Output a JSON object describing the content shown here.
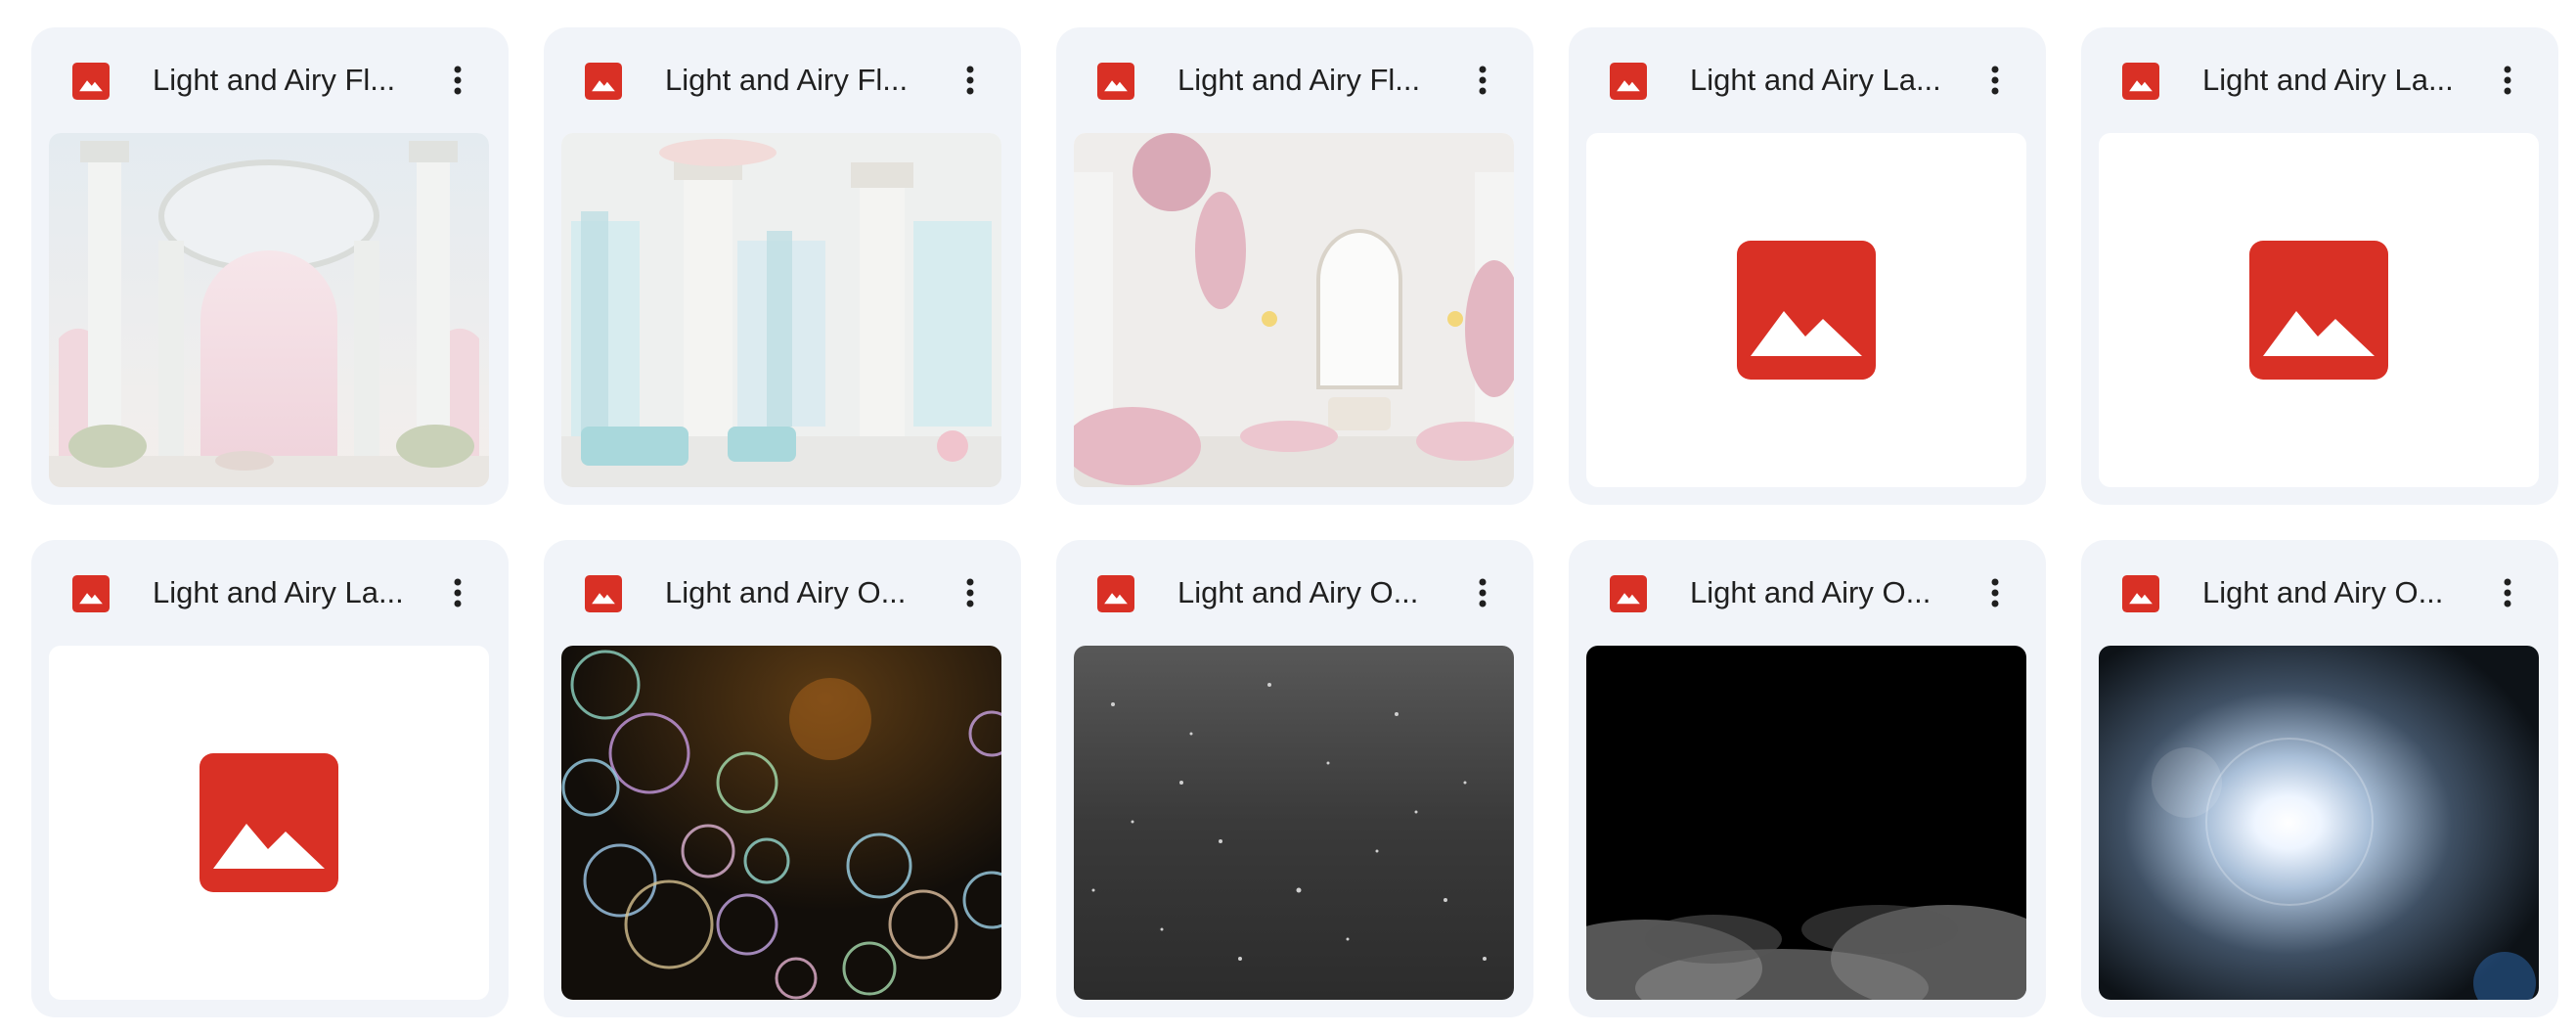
{
  "colors": {
    "card_bg": "#f1f4f9",
    "image_icon_red": "#d93025",
    "title_text": "#1f1f1f"
  },
  "files": [
    {
      "title": "Light and Airy Fl...",
      "thumbnail": "palace-pastel-arches",
      "file_icon": "image-file-icon"
    },
    {
      "title": "Light and Airy Fl...",
      "thumbnail": "palace-columns-blue-curtains",
      "file_icon": "image-file-icon"
    },
    {
      "title": "Light and Airy Fl...",
      "thumbnail": "palace-pink-florals",
      "file_icon": "image-file-icon"
    },
    {
      "title": "Light and Airy La...",
      "thumbnail": "image-placeholder-icon",
      "file_icon": "image-file-icon"
    },
    {
      "title": "Light and Airy La...",
      "thumbnail": "image-placeholder-icon",
      "file_icon": "image-file-icon"
    },
    {
      "title": "Light and Airy La...",
      "thumbnail": "image-placeholder-icon",
      "file_icon": "image-file-icon"
    },
    {
      "title": "Light and Airy O...",
      "thumbnail": "soap-bubbles-overlay",
      "file_icon": "image-file-icon"
    },
    {
      "title": "Light and Airy O...",
      "thumbnail": "dust-particles-overlay",
      "file_icon": "image-file-icon"
    },
    {
      "title": "Light and Airy O...",
      "thumbnail": "fog-smoke-overlay",
      "file_icon": "image-file-icon"
    },
    {
      "title": "Light and Airy O...",
      "thumbnail": "light-flare-overlay",
      "file_icon": "image-file-icon"
    }
  ]
}
